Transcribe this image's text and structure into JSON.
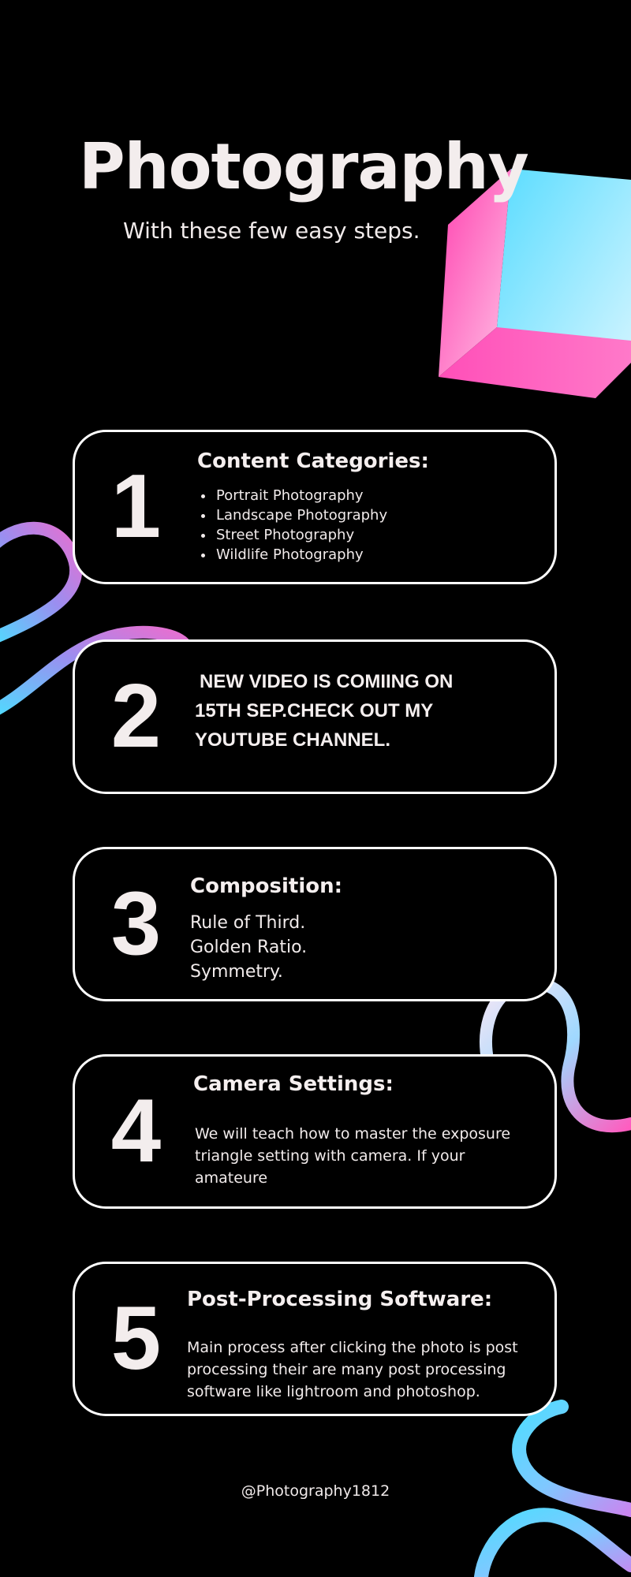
{
  "header": {
    "title": "Photography",
    "subtitle": "With these few easy steps."
  },
  "cards": [
    {
      "number": "1",
      "heading": "Content Categories:",
      "items": [
        "Portrait Photography",
        "Landscape Photography",
        "Street Photography",
        "Wildlife Photography"
      ]
    },
    {
      "number": "2",
      "lines": [
        "NEW VIDEO IS COMIING ON",
        "15TH SEP.CHECK OUT MY",
        "YOUTUBE CHANNEL."
      ]
    },
    {
      "number": "3",
      "heading": "Composition:",
      "lines": [
        "Rule of Third.",
        "Golden Ratio.",
        "Symmetry."
      ]
    },
    {
      "number": "4",
      "heading": "Camera Settings:",
      "lines": [
        "We will teach how to master the exposure",
        "triangle setting with camera. If your",
        "amateure"
      ]
    },
    {
      "number": "5",
      "heading": "Post-Processing Software:",
      "lines": [
        "Main process after clicking the photo is post",
        "processing their are many post processing",
        "software like lightroom and photoshop."
      ]
    }
  ],
  "footer": {
    "handle": "@Photography1812"
  },
  "colors": {
    "background": "#000000",
    "pink": "#ff4fb8",
    "cyan": "#4fdcff",
    "purple": "#b76ee0"
  },
  "decorations": [
    "cube-graphic",
    "swirl-left",
    "swirl-right",
    "swirl-bottom-right"
  ]
}
